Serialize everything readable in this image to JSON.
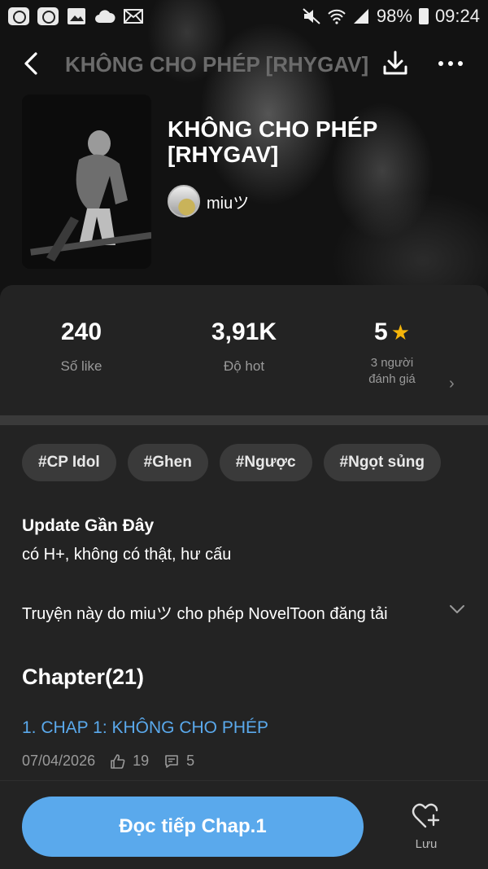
{
  "status_bar": {
    "battery": "98%",
    "time": "09:24",
    "icons": [
      "youtube-icon",
      "youtube-icon",
      "image-icon",
      "cloud-icon",
      "mail-icon",
      "mute-icon",
      "wifi-icon",
      "signal-icon",
      "battery-icon"
    ]
  },
  "header": {
    "title": "KHÔNG CHO PHÉP [RHYGAV]"
  },
  "book": {
    "title": "KHÔNG CHO PHÉP [RHYGAV]",
    "author": "miuツ"
  },
  "stats": [
    {
      "value": "240",
      "label": "Số like"
    },
    {
      "value": "3,91K",
      "label": "Độ hot"
    },
    {
      "value": "5",
      "label": "3 người\nđánh giá"
    }
  ],
  "tags": [
    "#CP Idol",
    "#Ghen",
    "#Ngược",
    "#Ngọt sủng"
  ],
  "update": {
    "title": "Update Gần Đây",
    "text": "có H+, không có thật, hư cấu"
  },
  "permission_text": "Truyện này do miuツ cho phép NovelToon đăng tải",
  "chapters": {
    "heading": "Chapter(21)",
    "items": [
      {
        "title": "1. CHAP 1: KHÔNG CHO PHÉP",
        "date": "07/04/2026",
        "likes": "19",
        "comments": "5"
      }
    ]
  },
  "bottom": {
    "read_label": "Đọc tiếp Chap.1",
    "save_label": "Lưu"
  },
  "colors": {
    "accent": "#5aa9ec",
    "star": "#f5b50a",
    "background": "#232323",
    "tag_bg": "#3a3a3a"
  }
}
